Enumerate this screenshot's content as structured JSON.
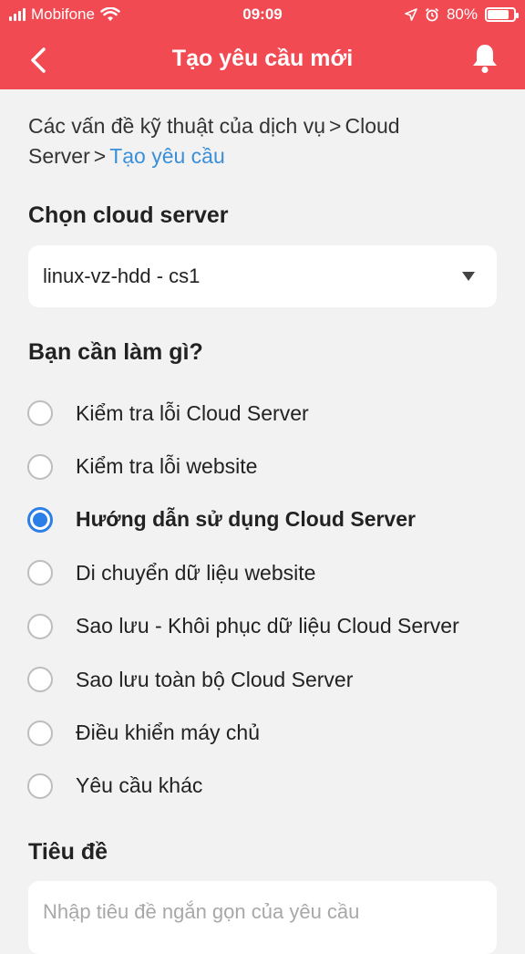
{
  "status_bar": {
    "carrier": "Mobifone",
    "time": "09:09",
    "battery": "80%",
    "battery_level": 0.8
  },
  "nav": {
    "title": "Tạo yêu cầu mới",
    "back_icon": "chevron-left-icon",
    "bell_icon": "bell-icon"
  },
  "breadcrumb": {
    "items": [
      "Các vấn đề kỹ thuật của dịch vụ",
      "Cloud Server"
    ],
    "separator": ">",
    "current": "Tạo yêu cầu"
  },
  "server_section": {
    "label": "Chọn cloud server",
    "selected": "linux-vz-hdd - cs1"
  },
  "task_section": {
    "label": "Bạn cần làm gì?",
    "options": [
      {
        "label": "Kiểm tra lỗi Cloud Server",
        "selected": false
      },
      {
        "label": "Kiểm tra lỗi website",
        "selected": false
      },
      {
        "label": "Hướng dẫn sử dụng Cloud Server",
        "selected": true
      },
      {
        "label": "Di chuyển dữ liệu website",
        "selected": false
      },
      {
        "label": "Sao lưu - Khôi phục dữ liệu Cloud Server",
        "selected": false
      },
      {
        "label": "Sao lưu toàn bộ Cloud Server",
        "selected": false
      },
      {
        "label": "Điều khiển máy chủ",
        "selected": false
      },
      {
        "label": "Yêu cầu khác",
        "selected": false
      }
    ]
  },
  "title_section": {
    "label": "Tiêu đề",
    "value": "",
    "placeholder": "Nhập tiêu đề ngắn gọn của yêu cầu"
  },
  "colors": {
    "header": "#f24a52",
    "link": "#3a8fd9",
    "radio_selected": "#2d7fe8"
  }
}
